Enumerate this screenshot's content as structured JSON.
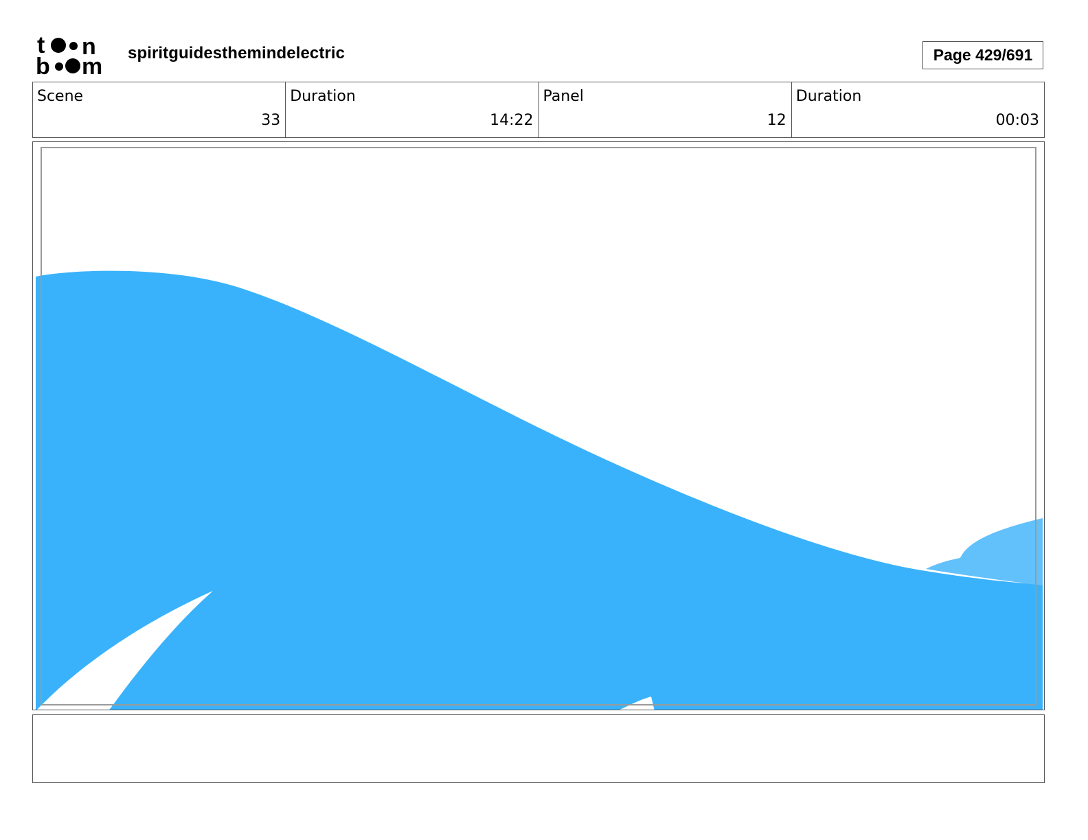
{
  "header": {
    "logo_name": "toon boom logo",
    "title": "spiritguidesthemindelectric",
    "page_label": "Page 429/691"
  },
  "info": {
    "scene_label": "Scene",
    "scene_value": "33",
    "scene_duration_label": "Duration",
    "scene_duration_value": "14:22",
    "panel_label": "Panel",
    "panel_value": "12",
    "panel_duration_label": "Duration",
    "panel_duration_value": "00:03"
  },
  "panel": {
    "fill_color": "#3ab2fb",
    "light_fill_color": "#62c0fb",
    "safe_frame_color": "#9a9a9a"
  },
  "notes": {
    "text": ""
  }
}
